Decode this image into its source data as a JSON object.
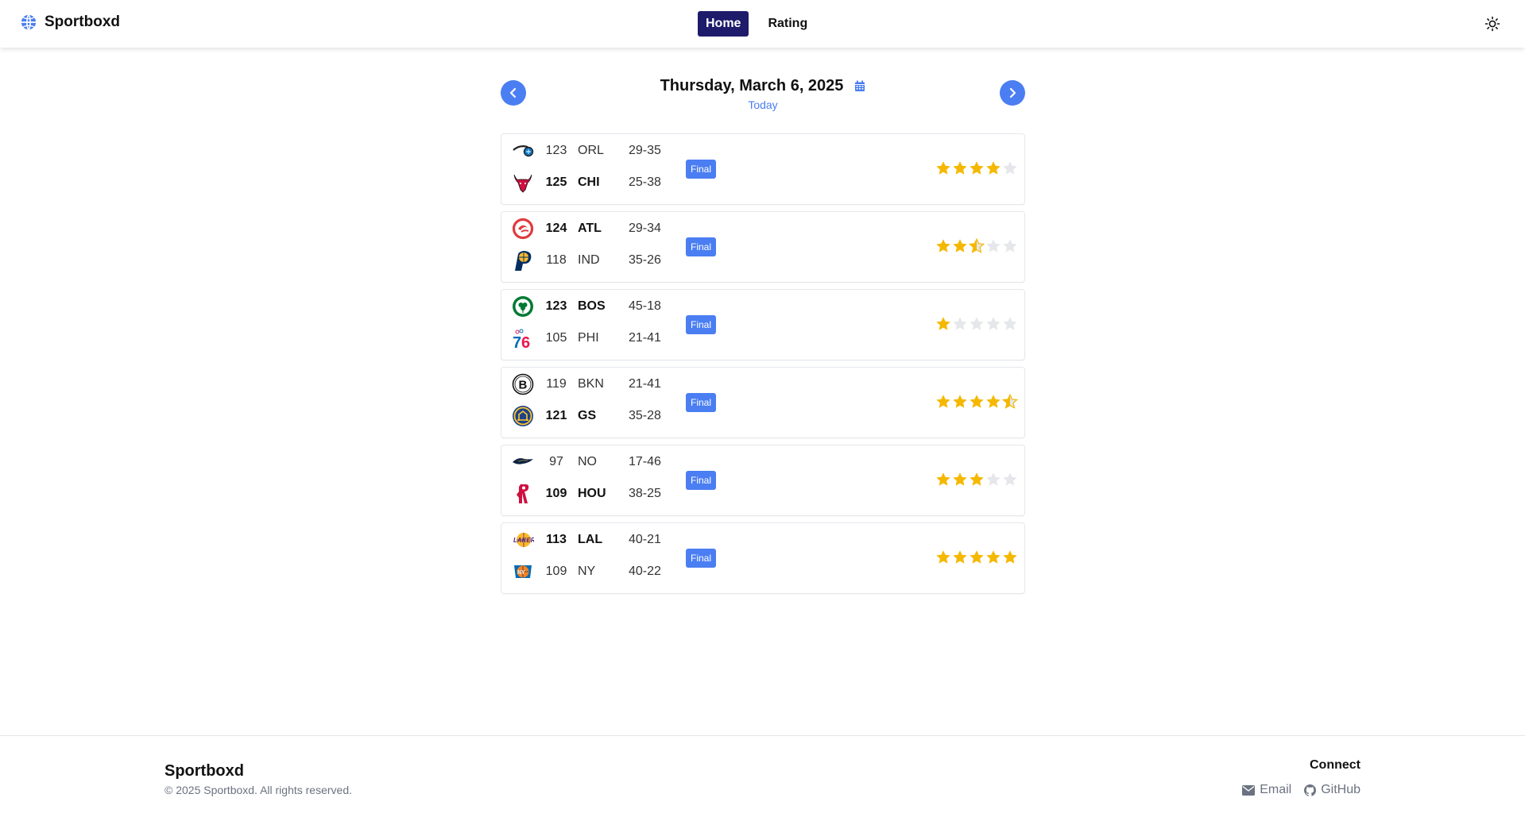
{
  "header": {
    "brand": "Sportboxd",
    "nav": [
      {
        "label": "Home",
        "active": true
      },
      {
        "label": "Rating",
        "active": false
      }
    ]
  },
  "date_nav": {
    "date": "Thursday, March 6, 2025",
    "sub": "Today"
  },
  "games": [
    {
      "status": "Final",
      "rating": 4,
      "away": {
        "logo": "magic-logo-icon",
        "score": "123",
        "abbr": "ORL",
        "record": "29-35",
        "winner": false
      },
      "home": {
        "logo": "bulls-logo-icon",
        "score": "125",
        "abbr": "CHI",
        "record": "25-38",
        "winner": true
      }
    },
    {
      "status": "Final",
      "rating": 2.5,
      "away": {
        "logo": "hawks-logo-icon",
        "score": "124",
        "abbr": "ATL",
        "record": "29-34",
        "winner": true
      },
      "home": {
        "logo": "pacers-logo-icon",
        "score": "118",
        "abbr": "IND",
        "record": "35-26",
        "winner": false
      }
    },
    {
      "status": "Final",
      "rating": 1,
      "away": {
        "logo": "celtics-logo-icon",
        "score": "123",
        "abbr": "BOS",
        "record": "45-18",
        "winner": true
      },
      "home": {
        "logo": "76ers-logo-icon",
        "score": "105",
        "abbr": "PHI",
        "record": "21-41",
        "winner": false
      }
    },
    {
      "status": "Final",
      "rating": 4.5,
      "away": {
        "logo": "nets-logo-icon",
        "score": "119",
        "abbr": "BKN",
        "record": "21-41",
        "winner": false
      },
      "home": {
        "logo": "warriors-logo-icon",
        "score": "121",
        "abbr": "GS",
        "record": "35-28",
        "winner": true
      }
    },
    {
      "status": "Final",
      "rating": 3,
      "away": {
        "logo": "pelicans-logo-icon",
        "score": "97",
        "abbr": "NO",
        "record": "17-46",
        "winner": false
      },
      "home": {
        "logo": "rockets-logo-icon",
        "score": "109",
        "abbr": "HOU",
        "record": "38-25",
        "winner": true
      }
    },
    {
      "status": "Final",
      "rating": 5,
      "away": {
        "logo": "lakers-logo-icon",
        "score": "113",
        "abbr": "LAL",
        "record": "40-21",
        "winner": true
      },
      "home": {
        "logo": "knicks-logo-icon",
        "score": "109",
        "abbr": "NY",
        "record": "40-22",
        "winner": false
      }
    }
  ],
  "footer": {
    "brand": "Sportboxd",
    "copyright": "© 2025 Sportboxd. All rights reserved.",
    "connect": "Connect",
    "links": [
      {
        "label": "Email",
        "icon": "envelope-icon"
      },
      {
        "label": "GitHub",
        "icon": "github-icon"
      }
    ]
  },
  "colors": {
    "accent": "#4a7ef2",
    "nav_active": "#1e1b6b",
    "star_filled": "#f5b800",
    "star_empty": "#e5e7eb"
  }
}
